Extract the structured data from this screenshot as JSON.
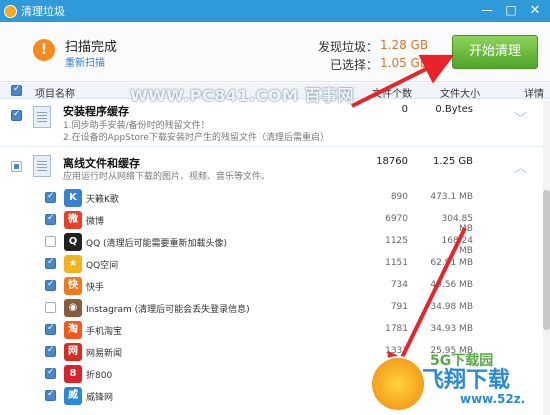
{
  "window": {
    "title": "清理垃圾",
    "controls": [
      "min",
      "max",
      "close"
    ]
  },
  "header": {
    "scan_title": "扫描完成",
    "rescan_label": "重新扫描",
    "found_label": "发现垃圾：",
    "found_value": "1.28 GB",
    "selected_label": "已选择：",
    "selected_value": "1.05 GB",
    "clean_button": "开始清理"
  },
  "columns": {
    "name": "项目名称",
    "count": "文件个数",
    "size": "文件大小",
    "detail": "详情"
  },
  "watermark": "WWW.PC841.COM 百事网",
  "logo": {
    "top": "5G下载园",
    "main": "飞翔下载",
    "sub": "www.52z."
  },
  "groups": [
    {
      "title": "安装程序缓存",
      "desc1": "1.同步助手安装/备份时的残留文件！",
      "desc2": "2.在设备的AppStore下载安装时产生的残留文件（清理后需重启）",
      "count": "0",
      "size": "0.Bytes",
      "checked": true
    },
    {
      "title": "离线文件和缓存",
      "desc1": "应用运行时从网络下载的图片、视频、音乐等文件。",
      "count": "18760",
      "size": "1.25 GB",
      "checked": "partial"
    }
  ],
  "apps": [
    {
      "name": "天籁K歌",
      "count": "890",
      "size": "473.1 MB",
      "checked": true,
      "icon": "k-song-icon",
      "color": "#3a7fd0",
      "glyph": "K"
    },
    {
      "name": "微博",
      "count": "6970",
      "size": "304.85 MB",
      "checked": true,
      "icon": "weibo-icon",
      "color": "#e8402a",
      "glyph": "微"
    },
    {
      "name": "QQ (清理后可能需要重新加载头像)",
      "count": "1125",
      "size": "168.24 MB",
      "checked": false,
      "icon": "qq-icon",
      "color": "#222222",
      "glyph": "Q"
    },
    {
      "name": "QQ空间",
      "count": "1151",
      "size": "62.91 MB",
      "checked": true,
      "icon": "qzone-icon",
      "color": "#f3b31b",
      "glyph": "★"
    },
    {
      "name": "快手",
      "count": "734",
      "size": "40.56 MB",
      "checked": true,
      "icon": "kuaishou-icon",
      "color": "#f07a1f",
      "glyph": "快"
    },
    {
      "name": "Instagram (清理后可能会丢失登录信息)",
      "count": "791",
      "size": "34.98 MB",
      "checked": false,
      "icon": "instagram-icon",
      "color": "#8a5a3c",
      "glyph": "◉"
    },
    {
      "name": "手机淘宝",
      "count": "1781",
      "size": "34.93 MB",
      "checked": true,
      "icon": "taobao-icon",
      "color": "#f5581c",
      "glyph": "淘"
    },
    {
      "name": "网易新闻",
      "count": "1333",
      "size": "25.95 MB",
      "checked": true,
      "icon": "netease-news-icon",
      "color": "#d42d22",
      "glyph": "网"
    },
    {
      "name": "折800",
      "count": "",
      "size": "",
      "checked": true,
      "icon": "zhe800-icon",
      "color": "#d9242c",
      "glyph": "8"
    },
    {
      "name": "威锋网",
      "count": "",
      "size": "",
      "checked": true,
      "icon": "weiphone-icon",
      "color": "#2a89d8",
      "glyph": "威"
    }
  ]
}
